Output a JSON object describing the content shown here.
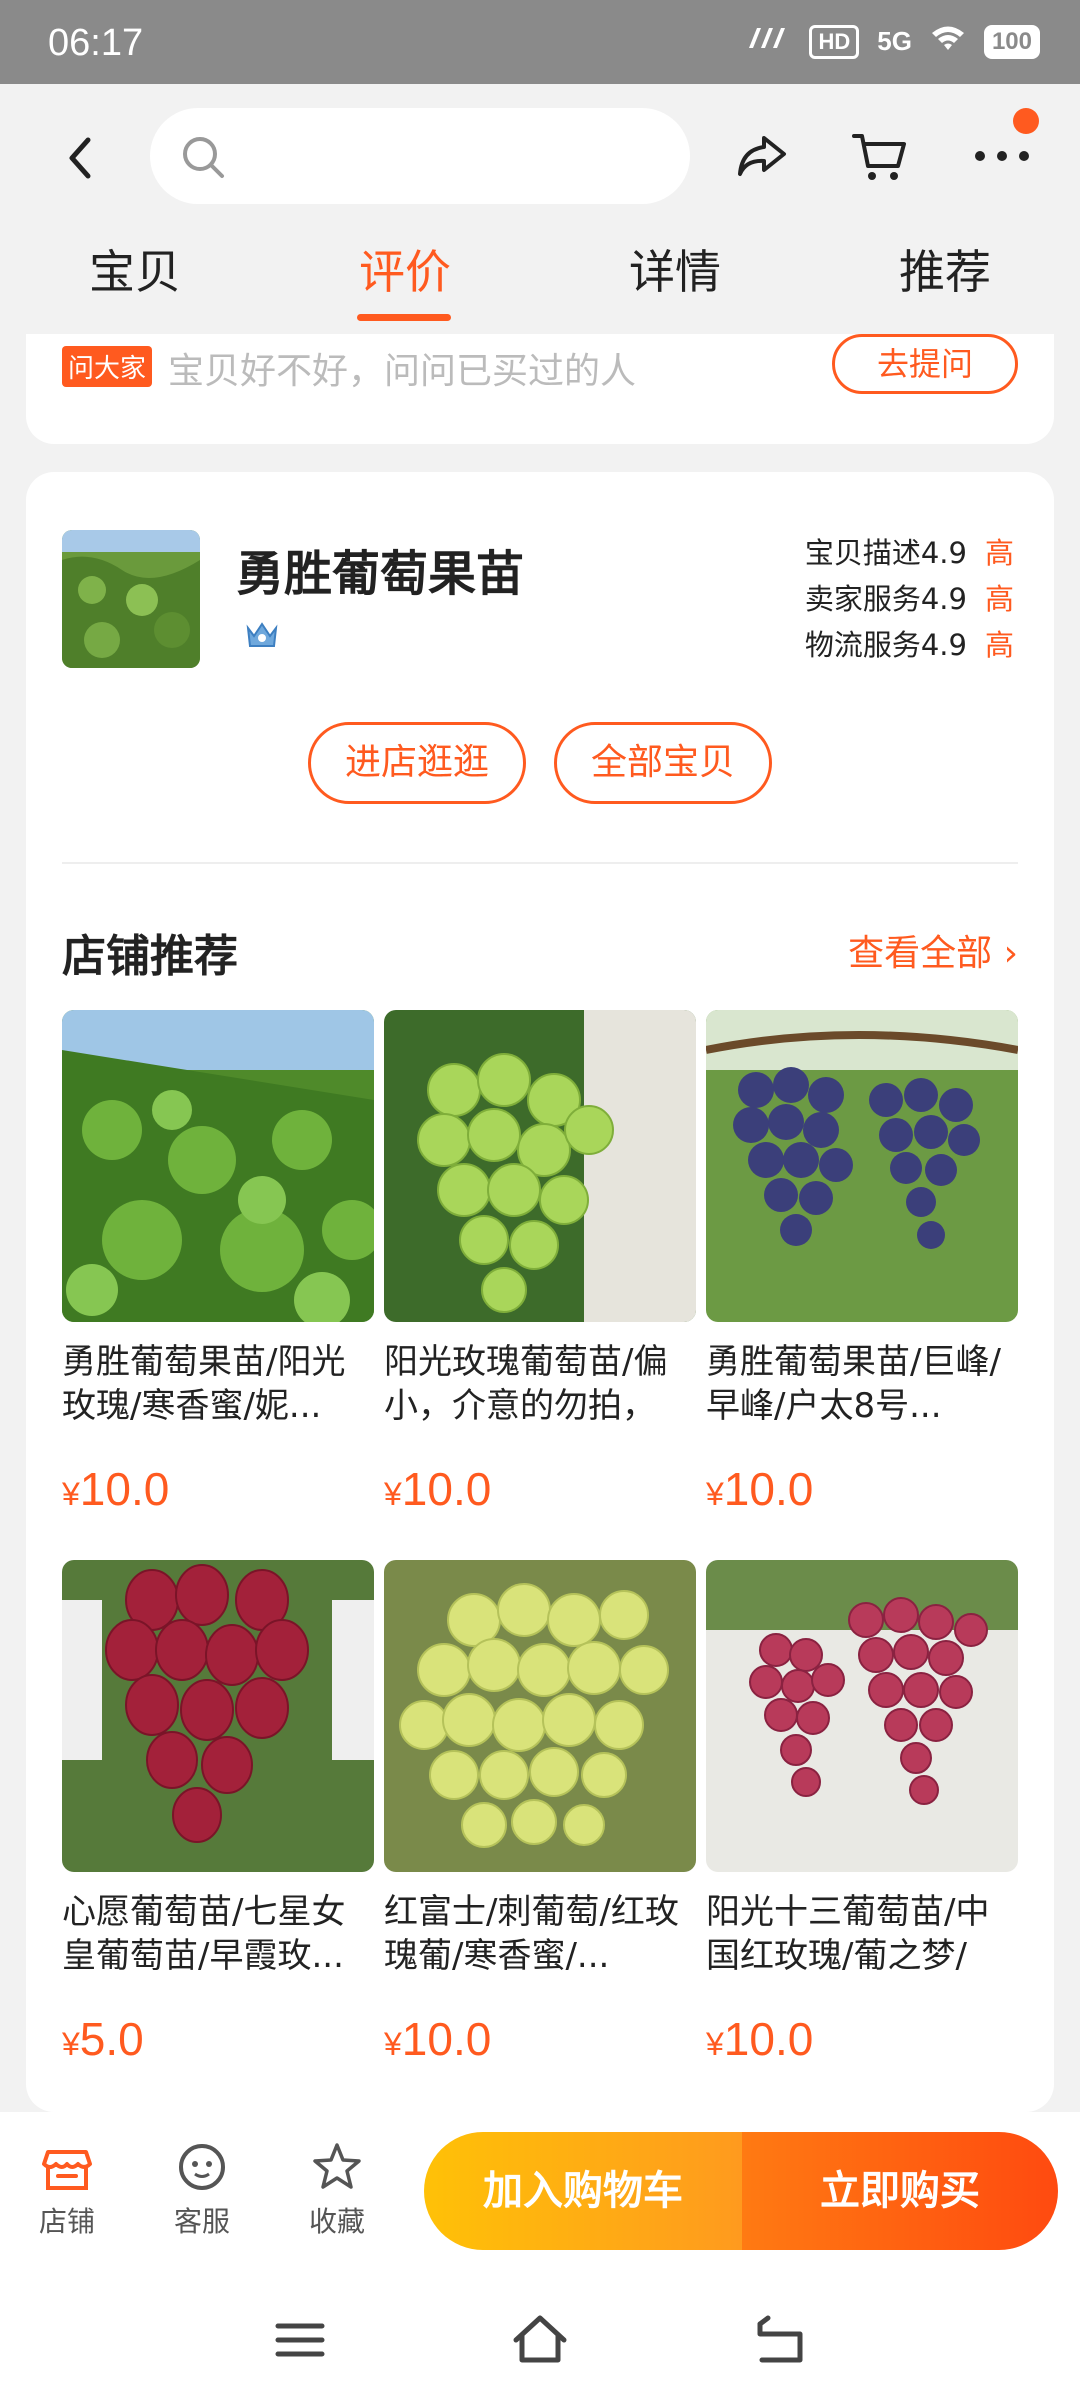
{
  "status": {
    "time": "06:17",
    "network": "5G",
    "hd": "HD",
    "battery": "100"
  },
  "tabs": [
    {
      "label": "宝贝"
    },
    {
      "label": "评价"
    },
    {
      "label": "详情"
    },
    {
      "label": "推荐"
    }
  ],
  "ask": {
    "tag": "问大家",
    "prompt": "宝贝好不好，问问已买过的人",
    "button": "去提问"
  },
  "store": {
    "name": "勇胜葡萄果苗",
    "ratings": [
      {
        "label": "宝贝描述",
        "value": "4.9",
        "level": "高"
      },
      {
        "label": "卖家服务",
        "value": "4.9",
        "level": "高"
      },
      {
        "label": "物流服务",
        "value": "4.9",
        "level": "高"
      }
    ],
    "visit_button": "进店逛逛",
    "all_items_button": "全部宝贝"
  },
  "recommend": {
    "title": "店铺推荐",
    "see_all": "查看全部 ›",
    "products": [
      {
        "title": "勇胜葡萄果苗/阳光玫瑰/寒香蜜/妮...",
        "currency": "¥",
        "price": "10.0",
        "image": "grape-seedling-field"
      },
      {
        "title": "阳光玫瑰葡萄苗/偏小，介意的勿拍，",
        "currency": "¥",
        "price": "10.0",
        "image": "green-grapes"
      },
      {
        "title": "勇胜葡萄果苗/巨峰/早峰/户太8号...",
        "currency": "¥",
        "price": "10.0",
        "image": "purple-grapes"
      },
      {
        "title": "心愿葡萄苗/七星女皇葡萄苗/早霞玫...",
        "currency": "¥",
        "price": "5.0",
        "image": "red-grapes"
      },
      {
        "title": "红富士/刺葡萄/红玫瑰葡/寒香蜜/...",
        "currency": "¥",
        "price": "10.0",
        "image": "yellow-green-grapes"
      },
      {
        "title": "阳光十三葡萄苗/中国红玫瑰/葡之梦/",
        "currency": "¥",
        "price": "10.0",
        "image": "pink-red-grapes"
      }
    ]
  },
  "bottom": {
    "shop": "店铺",
    "service": "客服",
    "favorite": "收藏",
    "add_to_cart": "加入购物车",
    "buy_now": "立即购买"
  },
  "colors": {
    "accent": "#ff5a1f",
    "cart_gradient": [
      "#ffc107",
      "#ff9a1e"
    ],
    "buy_gradient": [
      "#ff7a12",
      "#ff4a10"
    ]
  }
}
